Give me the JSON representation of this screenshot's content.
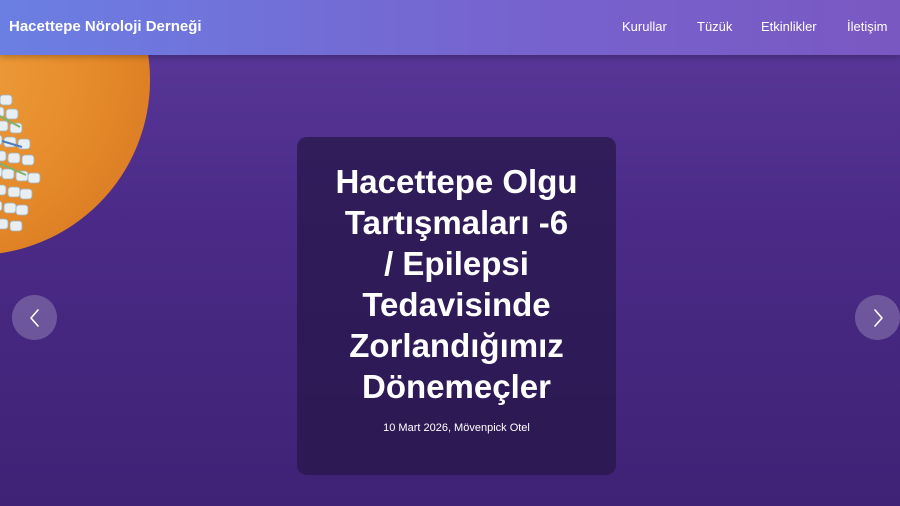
{
  "header": {
    "brand": "Hacettepe Nöroloji Derneği",
    "nav": [
      "Kurullar",
      "Tüzük",
      "Etkinlikler",
      "İletişim"
    ]
  },
  "hero": {
    "title_lines": [
      "Hacettepe Olgu",
      "Tartışmaları -6",
      "/ Epilepsi",
      "Tedavisinde",
      "Zorlandığımız",
      "Dönemeçler"
    ],
    "subtitle": "10 Mart 2026, Mövenpick Otel"
  },
  "colors": {
    "background": "#4a2a86",
    "header_start": "#6b7fe3",
    "header_end": "#7a58c2",
    "orb": "#e58a2a"
  },
  "icons": [
    "chevron-left-icon",
    "chevron-right-icon"
  ]
}
